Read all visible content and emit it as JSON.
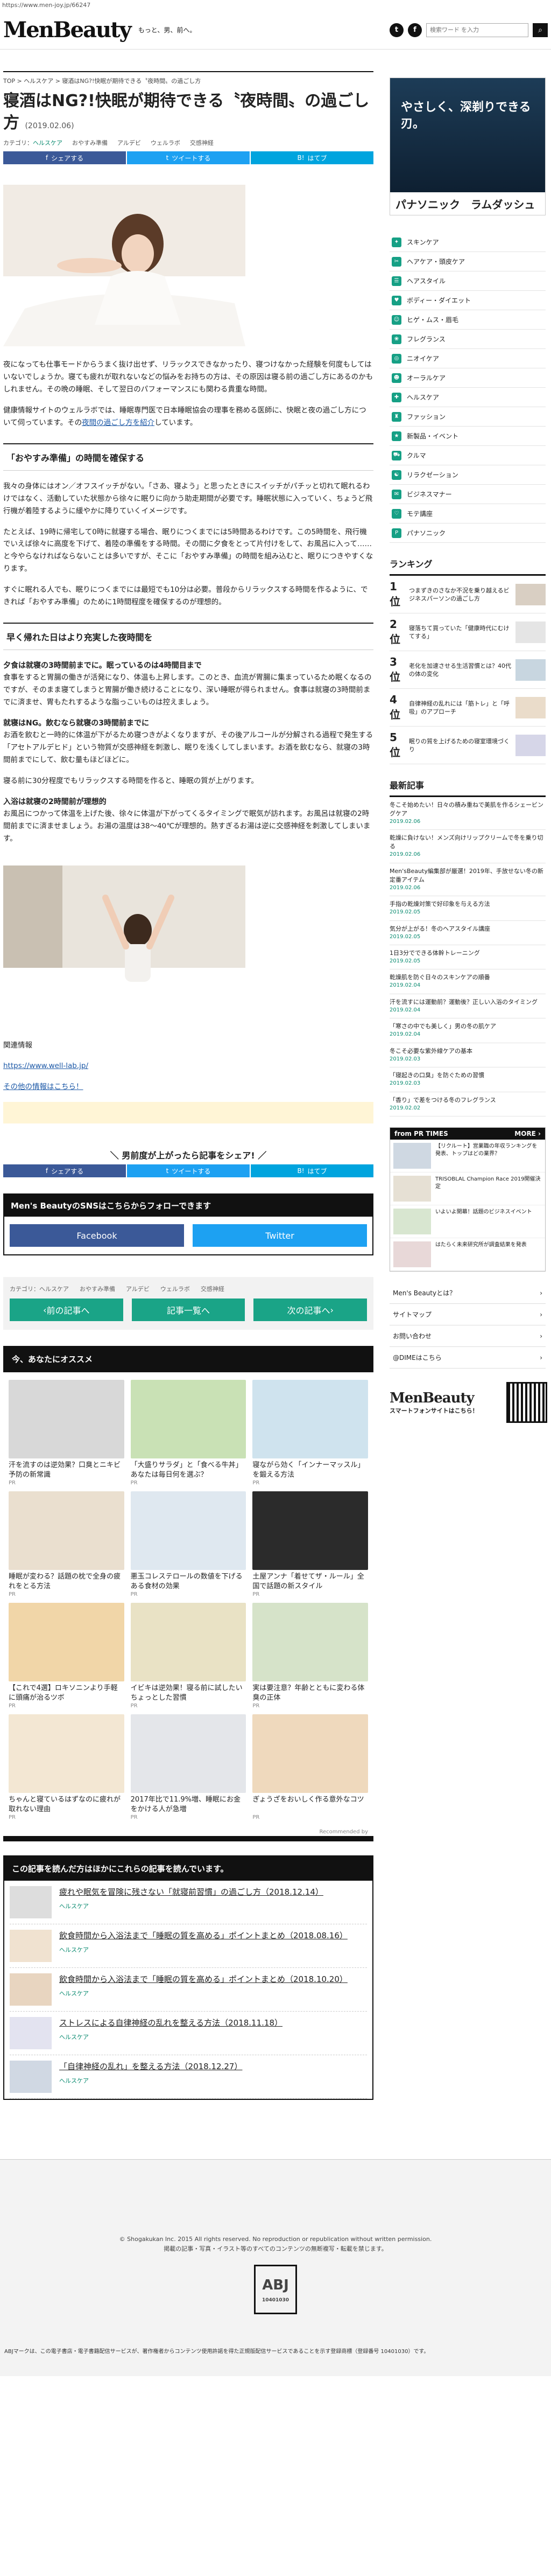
{
  "url": "https://www.men-joy.jp/66247",
  "header": {
    "logo": "MenBeauty",
    "tagline": "もっと、男、前へ。",
    "search_placeholder": "検索ワード を入力"
  },
  "breadcrumb": "TOP  >  ヘルスケア  >  寝酒はNG?!快眠が期待できる〝夜時間〟の過ごし方",
  "article": {
    "title": "寝酒はNG?!快眠が期待できる〝夜時間〟の過ごし方",
    "date": "(2019.02.06)",
    "category_label": "カテゴリ：",
    "category": "ヘルスケア",
    "tags": [
      "おやすみ準備",
      "アルデビ",
      "ウェルラボ",
      "交感神経"
    ],
    "share": {
      "facebook": "シェアする",
      "twitter": "ツイートする",
      "hatena": "はてブ"
    },
    "intro1": "夜になっても仕事モードからうまく抜け出せず、リラックスできなかったり、寝つけなかった経験を何度もしてはいないでしょうか。寝ても疲れが取れないなどの悩みをお持ちの方は、その原因は寝る前の過ごし方にあるのかもしれません。その晩の睡眠、そして翌日のパフォーマンスにも関わる貴重な時間。",
    "intro2_a": "健康情報サイトのウェルラボでは、睡眠専門医で日本睡眠協会の理事を務める医師に、快眠と夜の過ごし方について伺っています。その",
    "intro2_link": "夜間の過ごし方を紹介",
    "intro2_b": "しています。",
    "section1": "「おやすみ準備」の時間を確保する",
    "p1": "我々の身体にはオン／オフスイッチがない。「さあ、寝よう」と思ったときにスイッチがパチッと切れて眠れるわけではなく、活動していた状態から徐々に眠りに向かう助走期間が必要です。睡眠状態に入っていく、ちょうど飛行機が着陸するように緩やかに降りていくイメージです。",
    "p2": "たとえば、19時に帰宅して0時に就寝する場合、眠りにつくまでには5時間あるわけです。この5時間を、飛行機でいえば徐々に高度を下げて、着陸の準備をする時間。その間に夕食をとって片付けをして、お風呂に入って……と今やらなければならないことは多いですが、そこに「おやすみ準備」の時間を組み込むと、眠りにつきやすくなります。",
    "p3": "すぐに眠れる人でも、眠りにつくまでには最短でも10分は必要。普段からリラックスする時間を作るように、できれば「おやすみ準備」のために1時間程度を確保するのが理想的。",
    "section2": "早く帰れた日はより充実した夜時間を",
    "sub1": "夕食は就寝の3時間前までに。眠っているのは4時間目まで",
    "p4": "食事をすると胃腸の働きが活発になり、体温も上昇します。このとき、血流が胃腸に集まっているため眠くなるのですが、そのまま寝てしまうと胃腸が働き続けることになり、深い睡眠が得られません。食事は就寝の3時間前までに済ませ、胃もたれするような脂っこいものは控えましょう。",
    "sub2": "就寝はNG。飲むなら就寝の3時間前までに",
    "p5": "お酒を飲むと一時的に体温が下がるため寝つきがよくなりますが、その後アルコールが分解される過程で発生する「アセトアルデヒド」という物質が交感神経を刺激し、眠りを浅くしてしまいます。お酒を飲むなら、就寝の3時間前までにして、飲む量もほどほどに。",
    "p6": "寝る前に30分程度でもリラックスする時間を作ると、睡眠の質が上がります。",
    "sub3": "入浴は就寝の2時間前が理想的",
    "p7": "お風呂につかって体温を上げた後、徐々に体温が下がってくるタイミングで眠気が訪れます。お風呂は就寝の2時間前までに済ませましょう。お湯の温度は38〜40℃が理想的。熱すぎるお湯は逆に交感神経を刺激してしまいます。",
    "source_label": "関連情報",
    "source_url": "https://www.well-lab.jp/",
    "more_info": "その他の情報はこちら！",
    "share_title": "男前度が上がったら記事をシェア!",
    "follow_title": "Men's BeautyのSNSはこちらからフォローできます",
    "follow_facebook": "Facebook",
    "follow_twitter": "Twitter",
    "nav_prev": "前の記事へ",
    "nav_list": "記事一覧へ",
    "nav_next": "次の記事へ"
  },
  "recommend": {
    "title": "今、あなたにオススメ",
    "items": [
      {
        "caption": "汗を流すのは逆効果？口臭とニキビ予防の新常識",
        "source": "PR"
      },
      {
        "caption": "「大盛りサラダ」と「食べる牛丼」あなたは毎日何を選ぶ？",
        "source": "PR"
      },
      {
        "caption": "寝ながら効く「インナーマッスル」を鍛える方法",
        "source": "PR"
      },
      {
        "caption": "睡眠が変わる？話題の枕で全身の疲れをとる方法",
        "source": "PR"
      },
      {
        "caption": "悪玉コレステロールの数値を下げるある食材の効果",
        "source": "PR"
      },
      {
        "caption": "土屋アンナ「着せてザ・ルール」全国で話題の新スタイル",
        "source": "PR"
      },
      {
        "caption": "【これで4選】ロキソニンより手軽に頭痛が治るツボ",
        "source": "PR"
      },
      {
        "caption": "イビキは逆効果！寝る前に試したいちょっとした習慣",
        "source": "PR"
      },
      {
        "caption": "実は要注意？年齢とともに変わる体臭の正体",
        "source": "PR"
      },
      {
        "caption": "ちゃんと寝ているはずなのに疲れが取れない理由",
        "source": "PR"
      },
      {
        "caption": "2017年比で11.9%増、睡眠にお金をかける人が急増",
        "source": "PR"
      },
      {
        "caption": "ぎょうざをおいしく作る意外なコツ",
        "source": "PR"
      }
    ],
    "pr_label": "Recommended by"
  },
  "read_more": {
    "title": "この記事を読んだ方はほかにこれらの記事を読んでいます。",
    "items": [
      {
        "title": "疲れや眠気を冒険に残さない「就寝前習慣」の過ごし方（2018.12.14）",
        "category": "ヘルスケア"
      },
      {
        "title": "飲食時間から入浴法まで「睡眠の質を高める」ポイントまとめ（2018.08.16）",
        "category": "ヘルスケア"
      },
      {
        "title": "飲食時間から入浴法まで「睡眠の質を高める」ポイントまとめ（2018.10.20）",
        "category": "ヘルスケア"
      },
      {
        "title": "ストレスによる自律神経の乱れを整える方法（2018.11.18）",
        "category": "ヘルスケア"
      },
      {
        "title": "「自律神経の乱れ」を整える方法（2018.12.27）",
        "category": "ヘルスケア"
      }
    ]
  },
  "sidebar": {
    "ad_text": "やさしく、深剃りできる刃。",
    "ad_brand": "パナソニック　ラムダッシュ",
    "categories": [
      "スキンケア",
      "ヘアケア・頭皮ケア",
      "ヘアスタイル",
      "ボディー・ダイエット",
      "ヒゲ・ムス・眉毛",
      "フレグランス",
      "ニオイケア",
      "オーラルケア",
      "ヘルスケア",
      "ファッション",
      "新製品・イベント",
      "クルマ",
      "リラクゼーション",
      "ビジネスマナー",
      "モテ講座",
      "パナソニック"
    ],
    "ranking_title": "ランキング",
    "ranking": [
      {
        "rank": "1位",
        "text": "つまずきのさなか不況を乗り越えるビジネスパーソンの過ごし方"
      },
      {
        "rank": "2位",
        "text": "寝落ちて買っていた「健康時代にむけてする」"
      },
      {
        "rank": "3位",
        "text": "老化を加速させる生活習慣とは？40代の体の変化"
      },
      {
        "rank": "4位",
        "text": "自律神経の乱れには「筋トレ」と「呼吸」のアプローチ"
      },
      {
        "rank": "5位",
        "text": "眠りの質を上げるための寝室環境づくり"
      }
    ],
    "latest_title": "最新記事",
    "latest": [
      {
        "text": "冬こそ始めたい！日々の積み重ねで美肌を作るシェービングケア",
        "date": "2019.02.06"
      },
      {
        "text": "乾燥に負けない！メンズ向けリップクリームで冬を乗り切る",
        "date": "2019.02.06"
      },
      {
        "text": "Men'sBeauty編集部が厳選！2019年、手放せない冬の新定番アイテム",
        "date": "2019.02.06"
      },
      {
        "text": "手指の乾燥対策で好印象を与える方法",
        "date": "2019.02.05"
      },
      {
        "text": "気分が上がる！冬のヘアスタイル講座",
        "date": "2019.02.05"
      },
      {
        "text": "1日3分でできる体幹トレーニング",
        "date": "2019.02.05"
      },
      {
        "text": "乾燥肌を防ぐ日々のスキンケアの順番",
        "date": "2019.02.04"
      },
      {
        "text": "汗を流すには運動前？運動後？正しい入浴のタイミング",
        "date": "2019.02.04"
      },
      {
        "text": "「寒さの中でも美しく」男の冬の肌ケア",
        "date": "2019.02.04"
      },
      {
        "text": "冬こそ必要な紫外線ケアの基本",
        "date": "2019.02.03"
      },
      {
        "text": "「寝起きの口臭」を防ぐための習慣",
        "date": "2019.02.03"
      },
      {
        "text": "「香り」で差をつける冬のフレグランス",
        "date": "2019.02.02"
      }
    ],
    "pr_title": "from PR TIMES",
    "pr_more": "MORE ›",
    "pr_items": [
      "【リクルート】営業職の年収ランキングを発表、トップはどの業界？",
      "TRISOBLAL Champion Race 2019開催決定",
      "いよいよ開幕！話題のビジネスイベント",
      "はたらく未来研究所が調査結果を発表"
    ],
    "links": [
      "Men's Beautyとは？",
      "サイトマップ",
      "お問い合わせ",
      "@DIMEはこちら"
    ],
    "app_logo": "MenBeauty",
    "app_sub": "スマートフォンサイトはこちら！"
  },
  "footer": {
    "copyright": "© Shogakukan Inc. 2015  All rights reserved. No reproduction or republication without written permission.",
    "note1": "掲載の記事・写真・イラスト等のすべてのコンテンツの無断複写・転載を禁じます。",
    "adj_number": "10401030",
    "bottom_note": "ABJマークは、この電子書店・電子書籍配信サービスが、著作権者からコンテンツ使用許諾を得た正規版配信サービスであることを示す登録商標（登録番号 10401030）です。"
  },
  "colors": {
    "accent": "#1aa487",
    "facebook": "#3b5998",
    "twitter": "#1da1f2",
    "hatena": "#00a4de"
  }
}
